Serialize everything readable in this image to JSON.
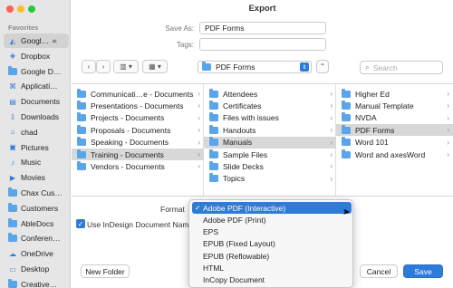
{
  "dialog": {
    "title": "Export",
    "save_as_label": "Save As:",
    "save_as_value": "PDF Forms",
    "tags_label": "Tags:",
    "tags_value": ""
  },
  "sidebar": {
    "section_label": "Favorites",
    "items": [
      {
        "label": "Googl…",
        "icon": "drive-icon"
      },
      {
        "label": "Dropbox",
        "icon": "dropbox-icon"
      },
      {
        "label": "Google D…",
        "icon": "folder-icon"
      },
      {
        "label": "Applicati…",
        "icon": "applications-icon"
      },
      {
        "label": "Documents",
        "icon": "document-icon"
      },
      {
        "label": "Downloads",
        "icon": "download-icon"
      },
      {
        "label": "chad",
        "icon": "home-icon"
      },
      {
        "label": "Pictures",
        "icon": "pictures-icon"
      },
      {
        "label": "Music",
        "icon": "music-icon"
      },
      {
        "label": "Movies",
        "icon": "movies-icon"
      },
      {
        "label": "Chax Cus…",
        "icon": "folder-icon"
      },
      {
        "label": "Customers",
        "icon": "folder-icon"
      },
      {
        "label": "AbleDocs",
        "icon": "folder-icon"
      },
      {
        "label": "Conferen…",
        "icon": "folder-icon"
      },
      {
        "label": "OneDrive",
        "icon": "cloud-icon"
      },
      {
        "label": "Desktop",
        "icon": "desktop-icon"
      },
      {
        "label": "Creative…",
        "icon": "folder-icon"
      }
    ]
  },
  "toolbar": {
    "location": "PDF Forms",
    "search_placeholder": "Search"
  },
  "columns": [
    {
      "rows": [
        {
          "label": "Communicati…e - Documents",
          "chevron": true
        },
        {
          "label": "Presentations - Documents",
          "chevron": true
        },
        {
          "label": "Projects - Documents",
          "chevron": true
        },
        {
          "label": "Proposals - Documents",
          "chevron": true
        },
        {
          "label": "Speaking - Documents",
          "chevron": true
        },
        {
          "label": "Training - Documents",
          "chevron": true,
          "selected": true
        },
        {
          "label": "Vendors - Documents",
          "chevron": true
        }
      ]
    },
    {
      "rows": [
        {
          "label": "Attendees",
          "chevron": true
        },
        {
          "label": "Certificates",
          "chevron": true
        },
        {
          "label": "Files with issues",
          "chevron": true
        },
        {
          "label": "Handouts",
          "chevron": true
        },
        {
          "label": "Manuals",
          "chevron": true,
          "selected": true
        },
        {
          "label": "Sample Files",
          "chevron": true
        },
        {
          "label": "Slide Decks",
          "chevron": true
        },
        {
          "label": "Topics",
          "chevron": true
        }
      ]
    },
    {
      "rows": [
        {
          "label": "Higher Ed",
          "chevron": true
        },
        {
          "label": "Manual Template",
          "chevron": true
        },
        {
          "label": "NVDA",
          "chevron": true
        },
        {
          "label": "PDF Forms",
          "chevron": true,
          "selected": true
        },
        {
          "label": "Word 101",
          "chevron": true
        },
        {
          "label": "Word and axesWord",
          "chevron": true
        }
      ]
    }
  ],
  "options": {
    "format_label": "Format",
    "checkbox_label": "Use InDesign Document Name",
    "format_options": [
      {
        "label": "Adobe PDF (Interactive)",
        "checked": true
      },
      {
        "label": "Adobe PDF (Print)"
      },
      {
        "label": "EPS"
      },
      {
        "label": "EPUB (Fixed Layout)"
      },
      {
        "label": "EPUB (Reflowable)"
      },
      {
        "label": "HTML"
      },
      {
        "label": "InCopy Document"
      }
    ]
  },
  "buttons": {
    "new_folder": "New Folder",
    "cancel": "Cancel",
    "save": "Save"
  },
  "colors": {
    "accent": "#2f7bd9",
    "folder": "#5aa5ea"
  }
}
